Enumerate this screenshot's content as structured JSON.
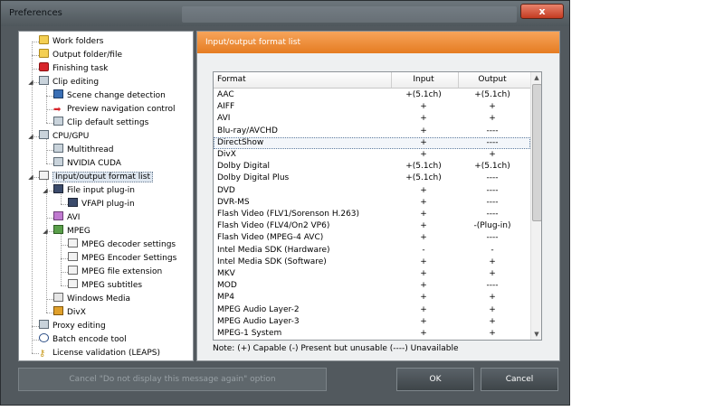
{
  "window": {
    "title": "Preferences",
    "close_label": "x"
  },
  "tree": {
    "items": [
      {
        "label": "Work folders",
        "icon": "folder-icon"
      },
      {
        "label": "Output folder/file",
        "icon": "folder-icon"
      },
      {
        "label": "Finishing task",
        "icon": "stop-icon"
      },
      {
        "label": "Clip editing",
        "icon": "grid-icon"
      },
      {
        "label": "Scene change detection",
        "icon": "scene-icon"
      },
      {
        "label": "Preview navigation control",
        "icon": "arrow-icon"
      },
      {
        "label": "Clip default settings",
        "icon": "grid-icon"
      },
      {
        "label": "CPU/GPU",
        "icon": "grid-icon"
      },
      {
        "label": "Multithread",
        "icon": "grid-icon"
      },
      {
        "label": "NVIDIA CUDA",
        "icon": "grid-icon"
      },
      {
        "label": "Input/output format list",
        "icon": "document-icon"
      },
      {
        "label": "File input plug-in",
        "icon": "monitor-icon"
      },
      {
        "label": "VFAPI plug-in",
        "icon": "monitor-icon"
      },
      {
        "label": "AVI",
        "icon": "avi-icon"
      },
      {
        "label": "MPEG",
        "icon": "mpeg-icon"
      },
      {
        "label": "MPEG decoder settings",
        "icon": "document-icon"
      },
      {
        "label": "MPEG Encoder Settings",
        "icon": "document-icon"
      },
      {
        "label": "MPEG file extension",
        "icon": "document-icon"
      },
      {
        "label": "MPEG subtitles",
        "icon": "document-icon"
      },
      {
        "label": "Windows Media",
        "icon": "windows-media-icon"
      },
      {
        "label": "DivX",
        "icon": "divx-icon"
      },
      {
        "label": "Proxy editing",
        "icon": "grid-icon"
      },
      {
        "label": "Batch encode tool",
        "icon": "clock-icon"
      },
      {
        "label": "License validation (LEAPS)",
        "icon": "key-icon"
      }
    ]
  },
  "panel": {
    "header": "Input/output format list",
    "columns": [
      "Format",
      "Input",
      "Output"
    ],
    "rows": [
      [
        "AAC",
        "+(5.1ch)",
        "+(5.1ch)"
      ],
      [
        "AIFF",
        "+",
        "+"
      ],
      [
        "AVI",
        "+",
        "+"
      ],
      [
        "Blu-ray/AVCHD",
        "+",
        "----"
      ],
      [
        "DirectShow",
        "+",
        "----"
      ],
      [
        "DivX",
        "+",
        "+"
      ],
      [
        "Dolby Digital",
        "+(5.1ch)",
        "+(5.1ch)"
      ],
      [
        "Dolby Digital Plus",
        "+(5.1ch)",
        "----"
      ],
      [
        "DVD",
        "+",
        "----"
      ],
      [
        "DVR-MS",
        "+",
        "----"
      ],
      [
        "Flash Video (FLV1/Sorenson H.263)",
        "+",
        "----"
      ],
      [
        "Flash Video (FLV4/On2 VP6)",
        "+",
        "-(Plug-in)"
      ],
      [
        "Flash Video (MPEG-4 AVC)",
        "+",
        "----"
      ],
      [
        "Intel Media SDK (Hardware)",
        "-",
        "-"
      ],
      [
        "Intel Media SDK (Software)",
        "+",
        "+"
      ],
      [
        "MKV",
        "+",
        "+"
      ],
      [
        "MOD",
        "+",
        "----"
      ],
      [
        "MP4",
        "+",
        "+"
      ],
      [
        "MPEG Audio Layer-2",
        "+",
        "+"
      ],
      [
        "MPEG Audio Layer-3",
        "+",
        "+"
      ],
      [
        "MPEG-1 System",
        "+",
        "+"
      ]
    ],
    "selected_row": "DirectShow",
    "note": "Note: (+) Capable   (-) Present but unusable   (----) Unavailable"
  },
  "buttons": {
    "cancel_dont_display": "Cancel \"Do not display this message again\" option",
    "ok": "OK",
    "cancel": "Cancel"
  },
  "colors": {
    "accent": "#e57c22",
    "window_bg": "#52595e"
  }
}
